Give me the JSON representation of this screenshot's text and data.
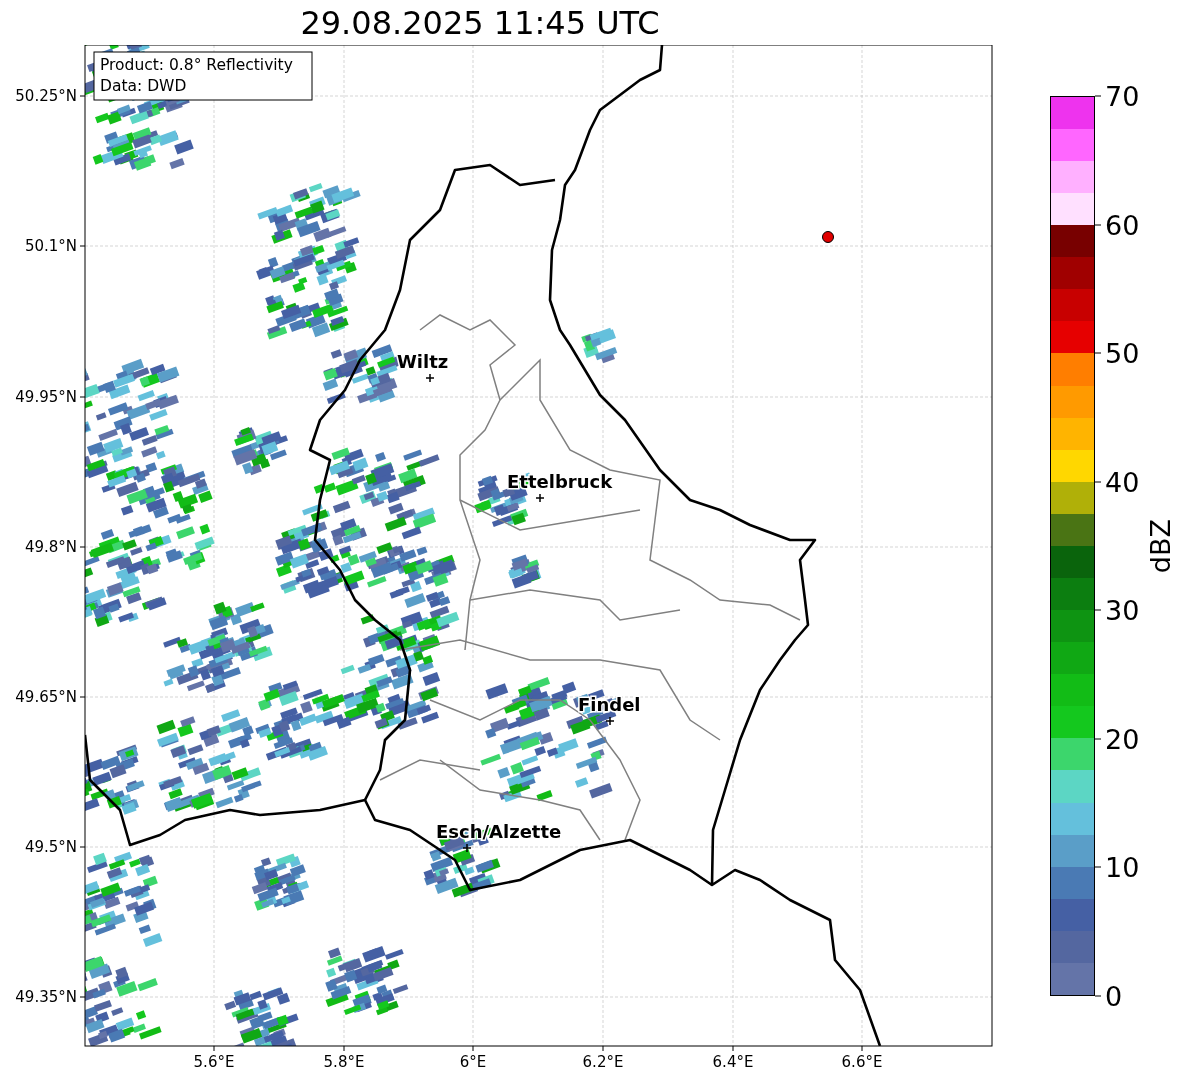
{
  "title": "29.08.2025 11:45 UTC",
  "map": {
    "info_box": [
      "Product: 0.8° Reflectivity",
      "Data: DWD"
    ],
    "places": [
      {
        "name": "Wiltz"
      },
      {
        "name": "Ettelbruck"
      },
      {
        "name": "Findel"
      },
      {
        "name": "Esch/Alzette"
      }
    ],
    "lat_ticks": [
      "50.25°N",
      "50.1°N",
      "49.95°N",
      "49.8°N",
      "49.65°N",
      "49.5°N",
      "49.35°N"
    ],
    "lon_ticks": [
      "5.6°E",
      "5.8°E",
      "6°E",
      "6.2°E",
      "6.4°E",
      "6.6°E"
    ]
  },
  "colorbar": {
    "label": "dBZ",
    "ticks": [
      "70",
      "60",
      "50",
      "40",
      "30",
      "20",
      "10",
      "0"
    ],
    "bins": [
      {
        "color": "#6474a8"
      },
      {
        "color": "#5467a0"
      },
      {
        "color": "#4560a4"
      },
      {
        "color": "#4a7ab4"
      },
      {
        "color": "#5a9ec8"
      },
      {
        "color": "#64c0dc"
      },
      {
        "color": "#5cd6c4"
      },
      {
        "color": "#3cd66c"
      },
      {
        "color": "#14c81e"
      },
      {
        "color": "#12bc16"
      },
      {
        "color": "#10a814"
      },
      {
        "color": "#0e9412"
      },
      {
        "color": "#0c7e10"
      },
      {
        "color": "#0a640c"
      },
      {
        "color": "#4a7414"
      },
      {
        "color": "#b0b008"
      },
      {
        "color": "#ffd700"
      },
      {
        "color": "#ffb400"
      },
      {
        "color": "#ff9a00"
      },
      {
        "color": "#ff7e00"
      },
      {
        "color": "#e60000"
      },
      {
        "color": "#c80000"
      },
      {
        "color": "#a00000"
      },
      {
        "color": "#780000"
      },
      {
        "color": "#ffe0ff"
      },
      {
        "color": "#ffb0ff"
      },
      {
        "color": "#ff66ff"
      },
      {
        "color": "#ee33ee"
      }
    ]
  }
}
